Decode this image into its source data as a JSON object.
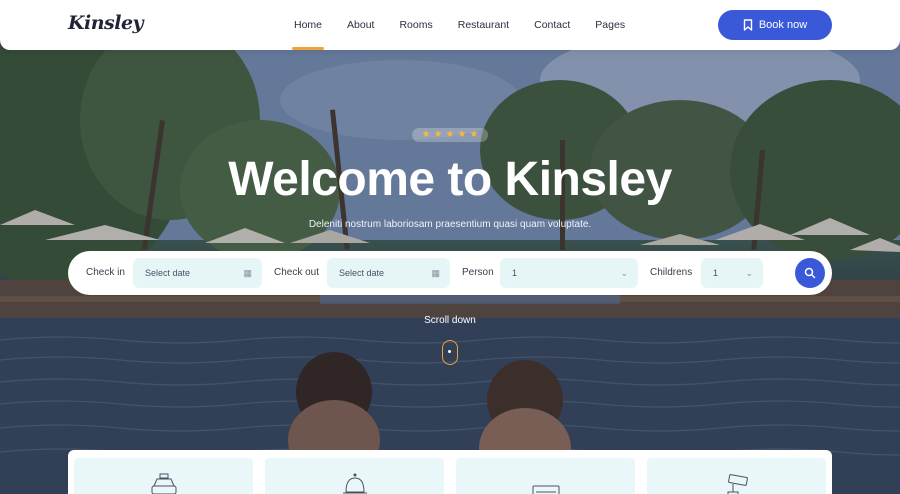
{
  "header": {
    "logo": "Kinsley",
    "nav": [
      "Home",
      "About",
      "Rooms",
      "Restaurant",
      "Contact",
      "Pages"
    ],
    "active_nav": "Home",
    "book_label": "Book now",
    "accent_color": "#3a59d9",
    "active_underline_color": "#f0a23b"
  },
  "hero": {
    "rating_stars": 5,
    "title": "Welcome to Kinsley",
    "subtitle": "Deleniti nostrum laboriosam praesentium quasi quam voluptate.",
    "scroll_label": "Scroll down"
  },
  "booking": {
    "checkin_label": "Check in",
    "checkin_placeholder": "Select date",
    "checkout_label": "Check out",
    "checkout_placeholder": "Select date",
    "person_label": "Person",
    "person_value": "1",
    "children_label": "Childrens",
    "children_value": "1",
    "search_icon": "search-icon"
  },
  "features": {
    "icons": [
      "taxi-icon",
      "service-bell-icon",
      "air-conditioner-icon",
      "security-camera-icon"
    ]
  }
}
